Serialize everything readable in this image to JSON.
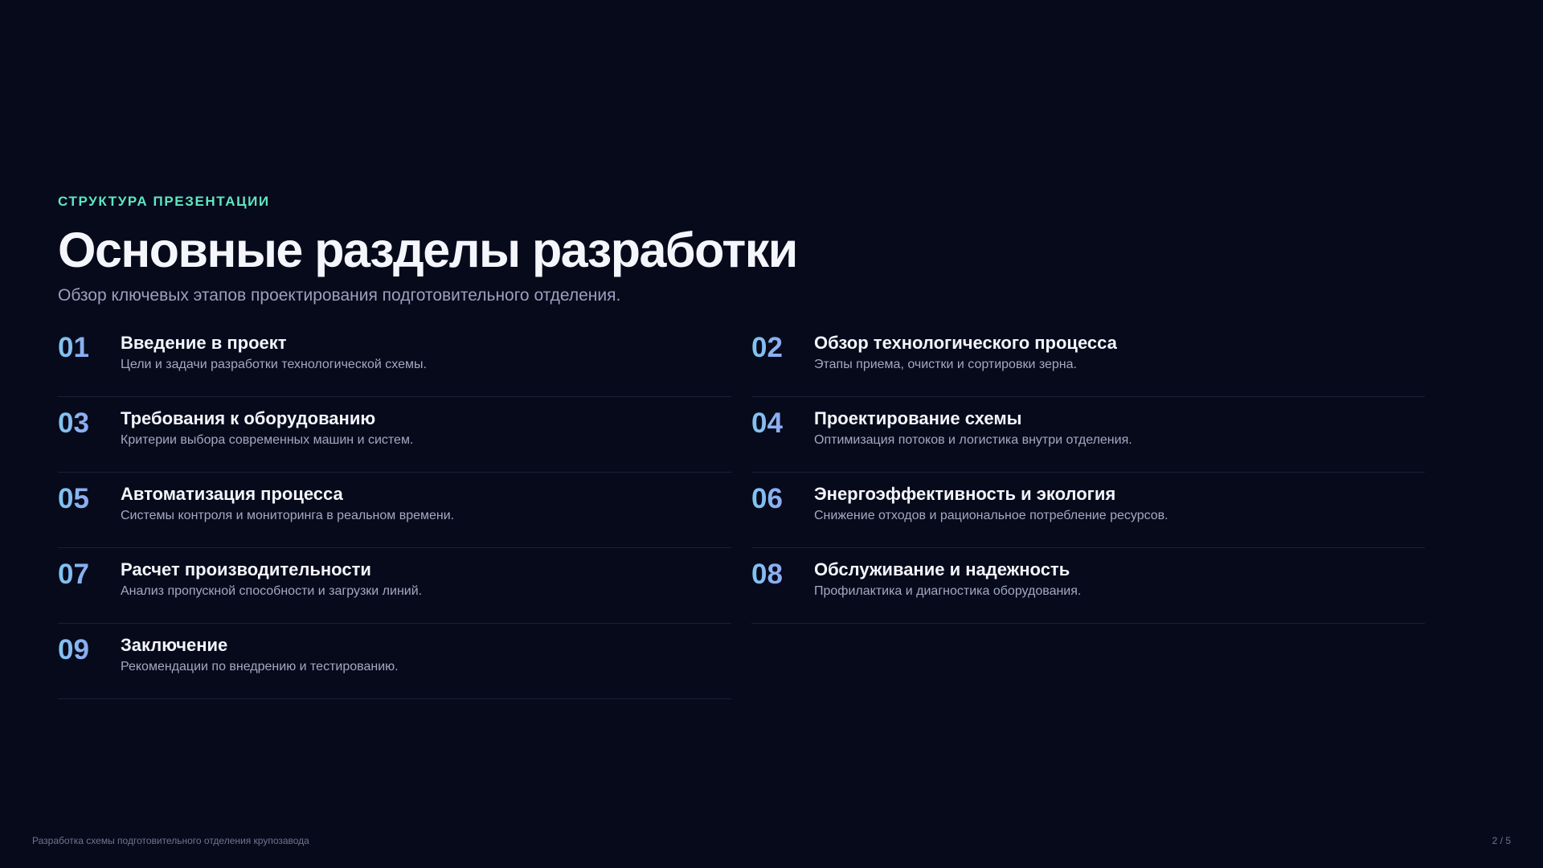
{
  "header": {
    "eyebrow": "СТРУКТУРА ПРЕЗЕНТАЦИИ",
    "title": "Основные разделы разработки",
    "subtitle": "Обзор ключевых этапов проектирования подготовительного отделения."
  },
  "sections": [
    {
      "num": "01",
      "title": "Введение в проект",
      "desc": "Цели и задачи разработки технологической схемы."
    },
    {
      "num": "02",
      "title": "Обзор технологического процесса",
      "desc": "Этапы приема, очистки и сортировки зерна."
    },
    {
      "num": "03",
      "title": "Требования к оборудованию",
      "desc": "Критерии выбора современных машин и систем."
    },
    {
      "num": "04",
      "title": "Проектирование схемы",
      "desc": "Оптимизация потоков и логистика внутри отделения."
    },
    {
      "num": "05",
      "title": "Автоматизация процесса",
      "desc": "Системы контроля и мониторинга в реальном времени."
    },
    {
      "num": "06",
      "title": "Энергоэффективность и экология",
      "desc": "Снижение отходов и рациональное потребление ресурсов."
    },
    {
      "num": "07",
      "title": "Расчет производительности",
      "desc": "Анализ пропускной способности и загрузки линий."
    },
    {
      "num": "08",
      "title": "Обслуживание и надежность",
      "desc": "Профилактика и диагностика оборудования."
    },
    {
      "num": "09",
      "title": "Заключение",
      "desc": "Рекомендации по внедрению и тестированию."
    }
  ],
  "footer": {
    "left": "Разработка схемы подготовительного отделения крупозавода",
    "page": "2 / 5"
  },
  "colors": {
    "background": "#070a1b",
    "accent_eyebrow": "#5ee6c1",
    "number_gradient_start": "#7fc7f0",
    "number_gradient_end": "#9c8bf2"
  }
}
